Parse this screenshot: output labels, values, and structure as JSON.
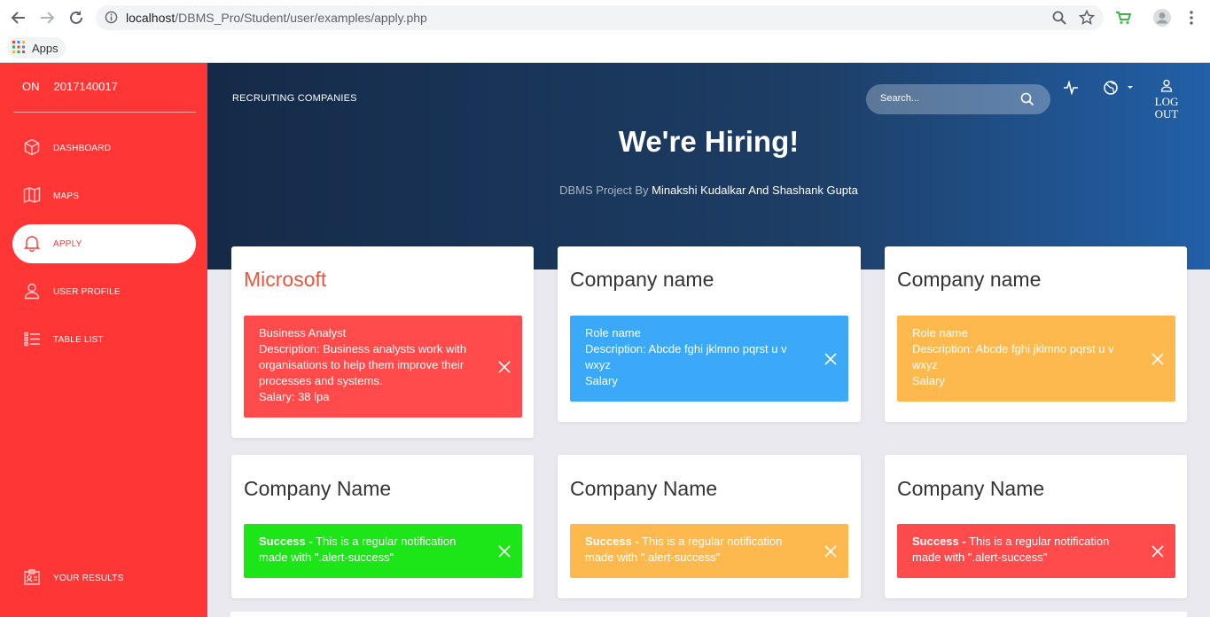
{
  "browser": {
    "url_host": "localhost",
    "url_path": "/DBMS_Pro/Student/user/examples/apply.php",
    "bookmarks_apps": "Apps"
  },
  "sidebar": {
    "prefix": "ON",
    "id": "2017140017",
    "items": [
      {
        "label": "DASHBOARD",
        "icon": "cube-icon"
      },
      {
        "label": "MAPS",
        "icon": "map-icon"
      },
      {
        "label": "APPLY",
        "icon": "bell-icon",
        "active": true
      },
      {
        "label": "USER PROFILE",
        "icon": "user-icon"
      },
      {
        "label": "TABLE LIST",
        "icon": "list-icon"
      }
    ],
    "footer_item": {
      "label": "YOUR RESULTS",
      "icon": "id-card-icon"
    }
  },
  "header": {
    "section_title": "RECRUITING COMPANIES",
    "search_placeholder": "Search...",
    "logout_line1": "LOG",
    "logout_line2": "OUT",
    "hero_title": "We're Hiring!",
    "credit_prefix": "DBMS Project By",
    "credit_names": "Minakshi Kudalkar And Shashank Gupta"
  },
  "cards": [
    {
      "company": "Microsoft",
      "color": "#ff4b4b",
      "lines": [
        "Business Analyst",
        "Description: Business analysts work with organisations to help them improve their processes and systems.",
        "Salary: 38 lpa"
      ]
    },
    {
      "company": "Company name",
      "color": "#3ba8f8",
      "lines": [
        "Role name",
        "Description: Abcde fghi jklmno pqrst u v wxyz",
        "Salary"
      ]
    },
    {
      "company": "Company name",
      "color": "#fdb94d",
      "lines": [
        "Role name",
        "Description: Abcde fghi jklmno pqrst u v wxyz",
        "Salary"
      ]
    },
    {
      "company": "Company Name",
      "color": "#1de618",
      "strong": "Success -",
      "text": "This is a regular notification made with \".alert-success\""
    },
    {
      "company": "Company Name",
      "color": "#fdb94d",
      "strong": "Success -",
      "text": "This is a regular notification made with \".alert-success\""
    },
    {
      "company": "Company Name",
      "color": "#ff4b4b",
      "strong": "Success -",
      "text": "This is a regular notification made with \".alert-success\""
    }
  ]
}
